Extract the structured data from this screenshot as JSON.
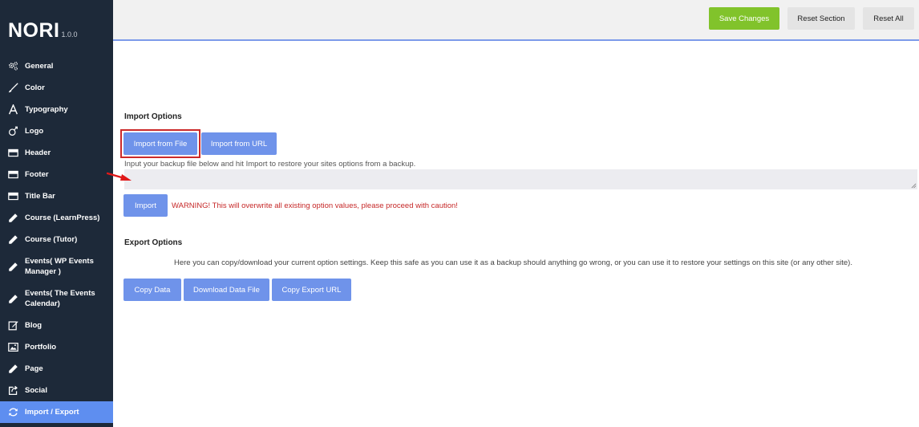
{
  "app": {
    "name": "NORI",
    "version": "1.0.0"
  },
  "sidebar": {
    "items": [
      {
        "label": "General",
        "icon": "gears-icon",
        "active": false
      },
      {
        "label": "Color",
        "icon": "brush-icon",
        "active": false
      },
      {
        "label": "Typography",
        "icon": "font-icon",
        "active": false
      },
      {
        "label": "Logo",
        "icon": "logo-icon",
        "active": false
      },
      {
        "label": "Header",
        "icon": "header-icon",
        "active": false
      },
      {
        "label": "Footer",
        "icon": "footer-icon",
        "active": false
      },
      {
        "label": "Title Bar",
        "icon": "title-bar-icon",
        "active": false
      },
      {
        "label": "Course (LearnPress)",
        "icon": "pencil-icon",
        "active": false
      },
      {
        "label": "Course (Tutor)",
        "icon": "pencil-icon",
        "active": false
      },
      {
        "label": "Events( WP Events Manager )",
        "icon": "pencil-icon",
        "active": false
      },
      {
        "label": "Events( The Events Calendar)",
        "icon": "pencil-icon",
        "active": false
      },
      {
        "label": "Blog",
        "icon": "edit-icon",
        "active": false
      },
      {
        "label": "Portfolio",
        "icon": "image-icon",
        "active": false
      },
      {
        "label": "Page",
        "icon": "pencil-icon",
        "active": false
      },
      {
        "label": "Social",
        "icon": "share-icon",
        "active": false
      },
      {
        "label": "Import / Export",
        "icon": "refresh-icon",
        "active": true
      }
    ]
  },
  "toolbar": {
    "save_label": "Save Changes",
    "reset_section_label": "Reset Section",
    "reset_all_label": "Reset All"
  },
  "import": {
    "title": "Import Options",
    "from_file_label": "Import from File",
    "from_url_label": "Import from URL",
    "help": "Input your backup file below and hit Import to restore your sites options from a backup.",
    "textarea_value": "",
    "import_label": "Import",
    "warning": "WARNING! This will overwrite all existing option values, please proceed with caution!"
  },
  "export": {
    "title": "Export Options",
    "description": "Here you can copy/download your current option settings. Keep this safe as you can use it as a backup should anything go wrong, or you can use it to restore your settings on this site (or any other site).",
    "copy_data_label": "Copy Data",
    "download_label": "Download Data File",
    "copy_url_label": "Copy Export URL"
  },
  "colors": {
    "sidebar_bg": "#1d2939",
    "active_item": "#5e8ef0",
    "button_blue": "#6f93ea",
    "save_green": "#81c32b",
    "warning_red": "#c62828",
    "annotation_red": "#cc2a2a"
  }
}
